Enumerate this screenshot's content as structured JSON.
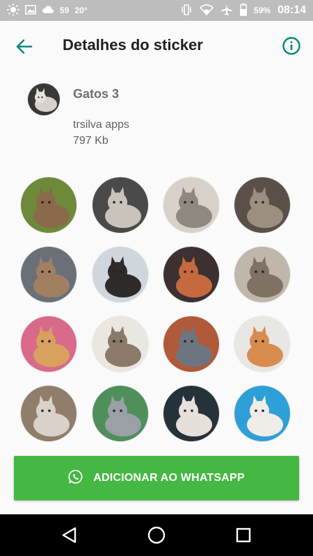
{
  "status_bar": {
    "notif_count": "59",
    "temperature": "20°",
    "battery": "59%",
    "time": "08:14"
  },
  "app_bar": {
    "title": "Detalhes do sticker"
  },
  "pack": {
    "name": "Gatos 3",
    "author": "trsilva apps",
    "size": "797 Kb"
  },
  "stickers": [
    {
      "bg": "#6d8a3a",
      "cat": "#8a6a4a"
    },
    {
      "bg": "#4a4a4a",
      "cat": "#c9c3bb"
    },
    {
      "bg": "#d8d1c8",
      "cat": "#8f8880"
    },
    {
      "bg": "#5a5048",
      "cat": "#9c8f80"
    },
    {
      "bg": "#6a7078",
      "cat": "#a08060"
    },
    {
      "bg": "#cfd6dc",
      "cat": "#2e2a28"
    },
    {
      "bg": "#3c3030",
      "cat": "#c46a3e"
    },
    {
      "bg": "#bfb7aa",
      "cat": "#7f7264"
    },
    {
      "bg": "#d96a8a",
      "cat": "#d9a060"
    },
    {
      "bg": "#eae6e0",
      "cat": "#8a7a6a"
    },
    {
      "bg": "#b05a3a",
      "cat": "#6d7680"
    },
    {
      "bg": "#e9e7e3",
      "cat": "#d88c50"
    },
    {
      "bg": "#8f7e6a",
      "cat": "#d8d2c8"
    },
    {
      "bg": "#4f8f5a",
      "cat": "#9aa0a6"
    },
    {
      "bg": "#26323a",
      "cat": "#e6e0da"
    },
    {
      "bg": "#2f9fd8",
      "cat": "#f0ede8"
    }
  ],
  "add_button": {
    "label": "ADICIONAR AO WHATSAPP",
    "color": "#45b843"
  },
  "colors": {
    "accent": "#00897b"
  }
}
